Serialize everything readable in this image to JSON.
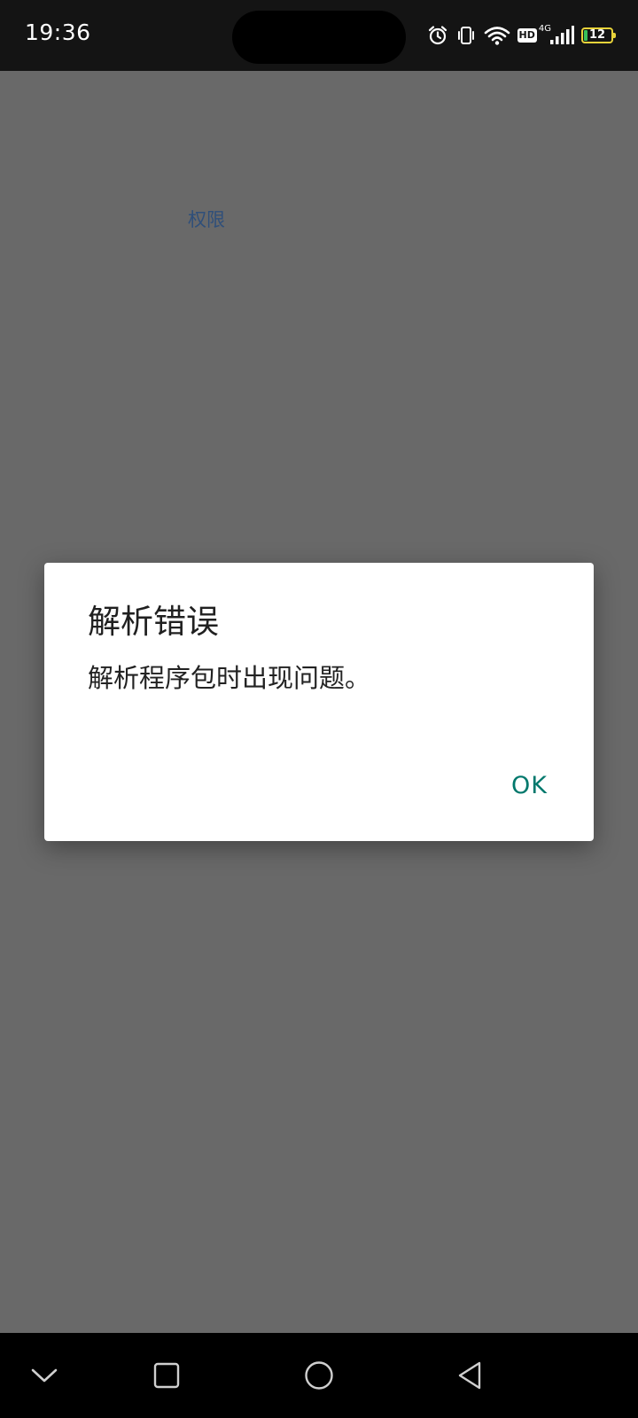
{
  "status_bar": {
    "time": "19:36",
    "icons": [
      "alarm-icon",
      "vibrate-icon",
      "wifi-icon",
      "hd-icon",
      "cellular-signal-icon",
      "battery-icon"
    ],
    "hd_label": "HD",
    "network_type": "4G",
    "battery_level": "12",
    "battery_fraction": 0.12,
    "battery_outline_color": "#e8d33a",
    "battery_fill_color": "#37c15a"
  },
  "background_page": {
    "permission_link": "权限"
  },
  "dialog": {
    "title": "解析错误",
    "message": "解析程序包时出现问题。",
    "ok_label": "OK",
    "ok_color": "#00786c"
  },
  "nav_bar": {
    "buttons": [
      "chevron-down-icon",
      "recent-apps-square-icon",
      "home-circle-icon",
      "back-triangle-icon"
    ]
  }
}
